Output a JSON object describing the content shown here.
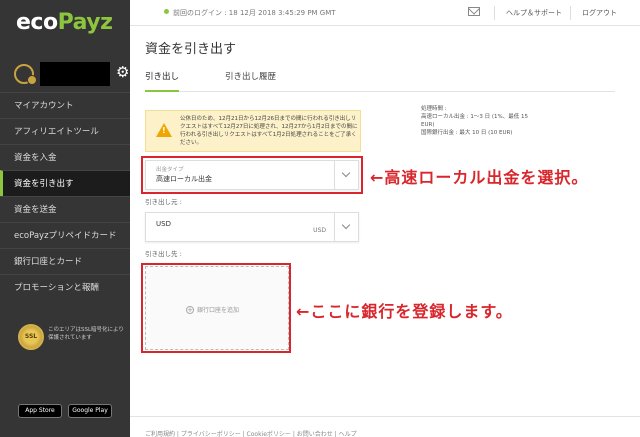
{
  "app": {
    "logo_eco": "eco",
    "logo_payz": "Payz"
  },
  "topbar": {
    "last_login": "前回のログイン : 18 12月 2018 3:45:29 PM GMT",
    "help_label": "ヘルプ＆サポート",
    "logout_label": "ログアウト"
  },
  "sidebar": {
    "items": [
      {
        "label": "マイアカウント"
      },
      {
        "label": "アフィリエイトツール"
      },
      {
        "label": "資金を入金"
      },
      {
        "label": "資金を引き出す"
      },
      {
        "label": "資金を送金"
      },
      {
        "label": "ecoPayzプリペイドカード"
      },
      {
        "label": "銀行口座とカード"
      },
      {
        "label": "プロモーションと報酬"
      }
    ],
    "ssl_badge": "SSL",
    "ssl_text": "このエリアはSSL暗号化により保護されています",
    "app_store": "App Store",
    "google_play": "Google Play"
  },
  "main": {
    "title": "資金を引き出す",
    "tabs": [
      {
        "label": "引き出し"
      },
      {
        "label": "引き出し履歴"
      }
    ],
    "warning_text": "公休日のため、12月21日から12月26日までの間に行われる引き出しリクエストはすべて12月27日に処理され、12月27から1月2日までの間に行われる引き出しリクエストはすべて1月2日処理されることをご了承ください。",
    "info": {
      "title": "処理時間 :",
      "line1": "高速ローカル出金 : 1〜3 日 (1%、最低 15 EUR)",
      "line2": "国際銀行出金 : 最大 10 日 (10 EUR)"
    },
    "withdraw_type": {
      "label": "出金タイプ",
      "value": "高速ローカル出金"
    },
    "from_label": "引き出し元 :",
    "from_account": {
      "value": "USD",
      "suffix": "USD"
    },
    "to_label": "引き出し先 :",
    "add_bank": "銀行口座を追加"
  },
  "annotations": {
    "select_note": "←高速ローカル出金を選択。",
    "register_note": "←ここに銀行を登録します。"
  },
  "footer": {
    "text": "ご利用規約 | プライバシーポリシー | Cookieポリシー | お問い合わせ | ヘルプ"
  },
  "colors": {
    "sidebar_bg": "#353535",
    "accent": "#8cc63f",
    "annotation_red": "#d9262c",
    "warning_bg": "#fcf1c9"
  }
}
